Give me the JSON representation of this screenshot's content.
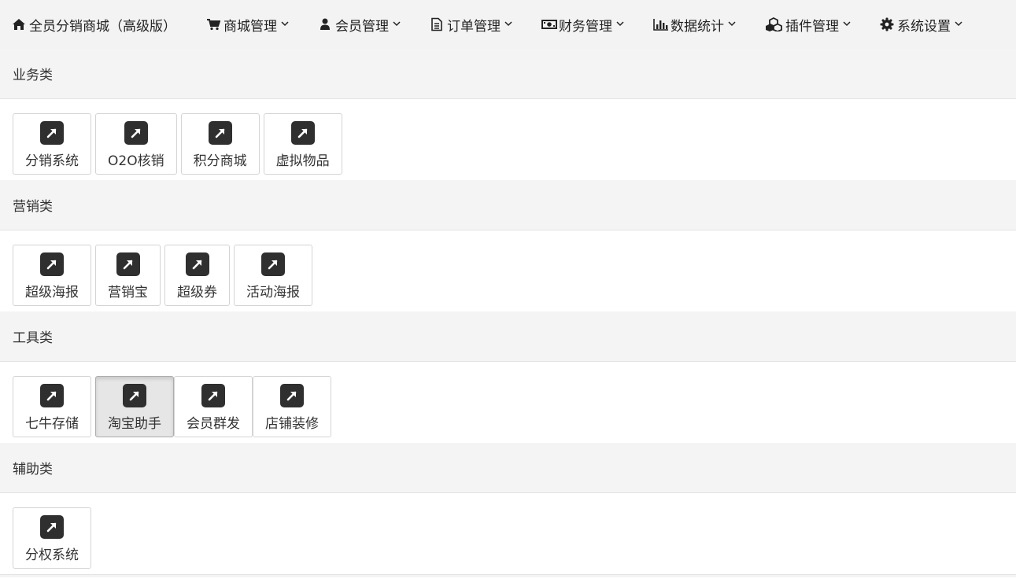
{
  "navbar": {
    "brand": {
      "icon": "home-icon",
      "label": "全员分销商城（高级版）"
    },
    "items": [
      {
        "icon": "cart-icon",
        "label": "商城管理"
      },
      {
        "icon": "user-icon",
        "label": "会员管理"
      },
      {
        "icon": "file-icon",
        "label": "订单管理"
      },
      {
        "icon": "money-icon",
        "label": "财务管理"
      },
      {
        "icon": "bar-chart-icon",
        "label": "数据统计"
      },
      {
        "icon": "cubes-icon",
        "label": "插件管理"
      },
      {
        "icon": "gear-icon",
        "label": "系统设置"
      }
    ]
  },
  "sections": [
    {
      "title": "业务类",
      "items": [
        {
          "label": "分销系统"
        },
        {
          "label": "O2O核销"
        },
        {
          "label": "积分商城"
        },
        {
          "label": "虚拟物品"
        }
      ]
    },
    {
      "title": "营销类",
      "items": [
        {
          "label": "超级海报"
        },
        {
          "label": "营销宝"
        },
        {
          "label": "超级券"
        },
        {
          "label": "活动海报"
        }
      ]
    },
    {
      "title": "工具类",
      "items": [
        {
          "label": "七牛存储"
        },
        {
          "label": "淘宝助手",
          "active": true
        },
        {
          "label": "会员群发"
        },
        {
          "label": "店铺装修"
        }
      ]
    },
    {
      "title": "辅助类",
      "items": [
        {
          "label": "分权系统"
        }
      ]
    }
  ],
  "tile_icon": "external-link-arrow-icon",
  "colors": {
    "navbar_bg": "#f3f3f3",
    "section_head_bg": "#f4f4f4",
    "tile_icon_bg": "#2f2f2f",
    "active_tile_bg": "#e6e6e6"
  }
}
